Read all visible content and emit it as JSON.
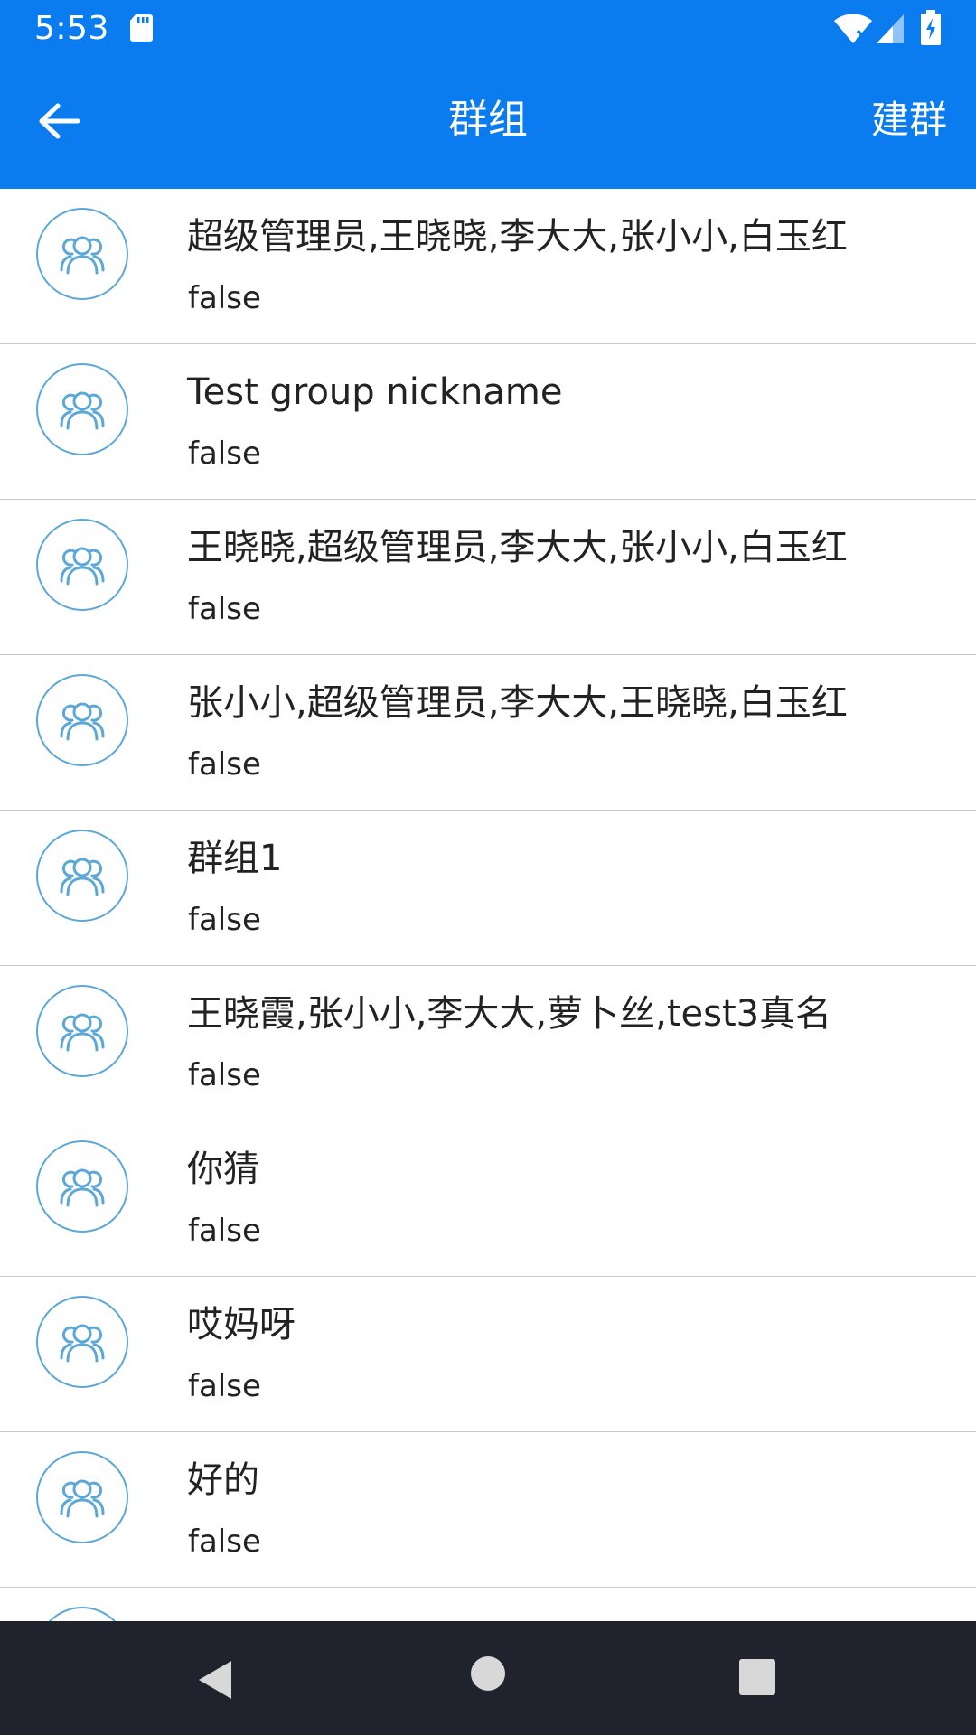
{
  "status_bar": {
    "time": "5:53",
    "icons": [
      "sd-card-icon",
      "wifi-icon",
      "signal-icon",
      "battery-charging-icon"
    ]
  },
  "app_bar": {
    "title": "群组",
    "action_label": "建群",
    "back_icon": "arrow-left-icon"
  },
  "colors": {
    "primary": "#0a7cf0",
    "avatar_stroke": "#5ba8d8",
    "divider": "#c8c8c8",
    "nav_bar": "#20232e"
  },
  "groups": [
    {
      "name": "超级管理员,王晓晓,李大大,张小小,白玉红",
      "status": "false"
    },
    {
      "name": "Test group nickname",
      "status": "false"
    },
    {
      "name": "王晓晓,超级管理员,李大大,张小小,白玉红",
      "status": "false"
    },
    {
      "name": "张小小,超级管理员,李大大,王晓晓,白玉红",
      "status": "false"
    },
    {
      "name": "群组1",
      "status": "false"
    },
    {
      "name": "王晓霞,张小小,李大大,萝卜丝,test3真名",
      "status": "false"
    },
    {
      "name": "你猜",
      "status": "false"
    },
    {
      "name": "哎妈呀",
      "status": "false"
    },
    {
      "name": "好的",
      "status": "false"
    }
  ],
  "nav_bar": {
    "icons": [
      "nav-back-icon",
      "nav-home-icon",
      "nav-recents-icon"
    ]
  }
}
